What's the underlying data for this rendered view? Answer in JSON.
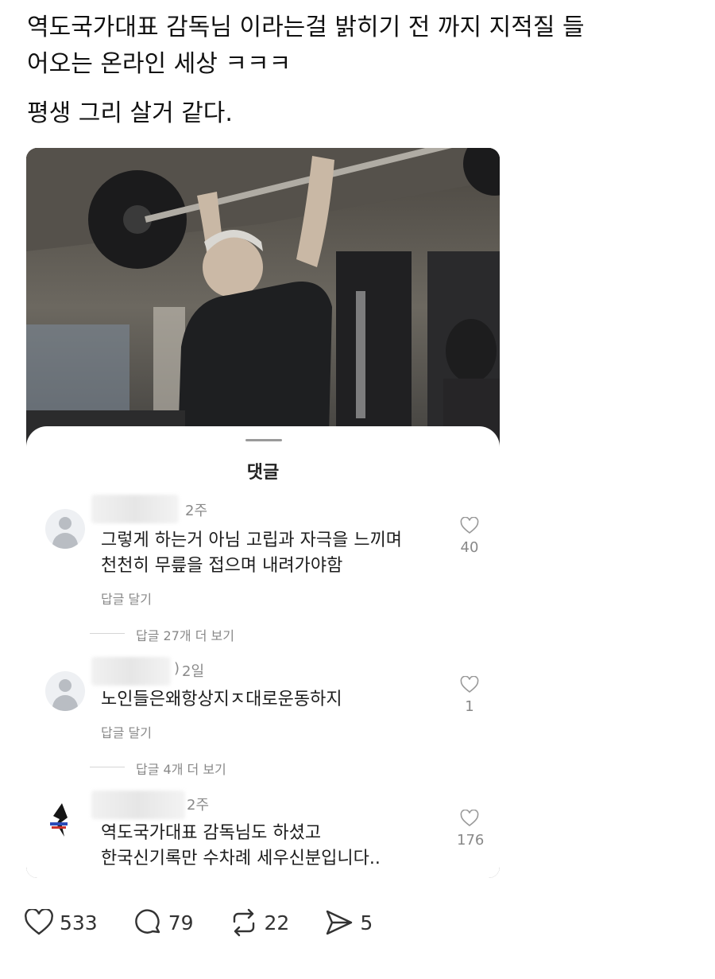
{
  "post": {
    "line1": "역도국가대표 감독님 이라는걸 밝히기 전 까지 지적질 들",
    "line2": "어오는 온라인 세상 ㅋㅋㅋ",
    "line3": "평생 그리 살거 같다."
  },
  "embed": {
    "photo_icon": "gym-photo",
    "sheet_title": "댓글",
    "comments": [
      {
        "time": "2주",
        "text_line1": "그렇게 하는거 아님 고립과 자극을 느끼며",
        "text_line2": "천천히 무릎을 접으며 내려가야함",
        "reply_label": "답글 달기",
        "likes": "40",
        "more_replies": "답글 27개 더 보기"
      },
      {
        "time": "2일",
        "name_tail": ")",
        "text_line1": "노인들은왜항상지ㅈ대로운동하지",
        "reply_label": "답글 달기",
        "likes": "1",
        "more_replies": "답글 4개 더 보기"
      },
      {
        "time": "2주",
        "text_line1": "역도국가대표 감독님도 하셨고",
        "text_line2": "한국신기록만 수차례 세우신분입니다..",
        "likes": "176"
      }
    ]
  },
  "actions": {
    "likes": "533",
    "comments": "79",
    "reposts": "22",
    "shares": "5"
  },
  "icons": {
    "like": "heart-icon",
    "comment": "comment-bubble-icon",
    "repost": "repost-icon",
    "share": "send-icon",
    "avatar": "user-avatar-icon"
  }
}
